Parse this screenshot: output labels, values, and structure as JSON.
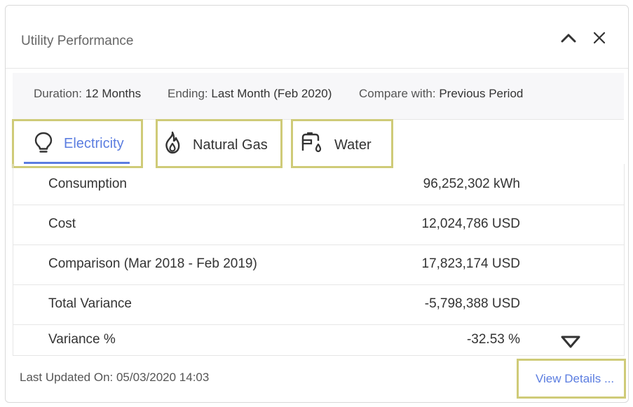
{
  "panel": {
    "title": "Utility Performance"
  },
  "filters": [
    {
      "label": "Duration:",
      "value": "12 Months"
    },
    {
      "label": "Ending:",
      "value": "Last Month (Feb 2020)"
    },
    {
      "label": "Compare with:",
      "value": "Previous Period"
    }
  ],
  "tabs": [
    {
      "label": "Electricity",
      "icon": "lightbulb-icon",
      "active": true
    },
    {
      "label": "Natural Gas",
      "icon": "flame-icon",
      "active": false
    },
    {
      "label": "Water",
      "icon": "faucet-icon",
      "active": false
    }
  ],
  "metrics": [
    {
      "label": "Consumption",
      "value": "96,252,302 kWh"
    },
    {
      "label": "Cost",
      "value": "12,024,786 USD"
    },
    {
      "label": "Comparison (Mar 2018 - Feb 2019)",
      "value": "17,823,174 USD"
    },
    {
      "label": "Total Variance",
      "value": "-5,798,388 USD"
    },
    {
      "label": "Variance %",
      "value": "-32.53 %",
      "trend_icon": "triangle-down-icon"
    }
  ],
  "footer": {
    "last_updated": "Last Updated On: 05/03/2020 14:03",
    "view_details": "View Details ..."
  },
  "colors": {
    "accent": "#5b7de0",
    "highlight_border": "#cfcb78",
    "text": "#333333"
  }
}
